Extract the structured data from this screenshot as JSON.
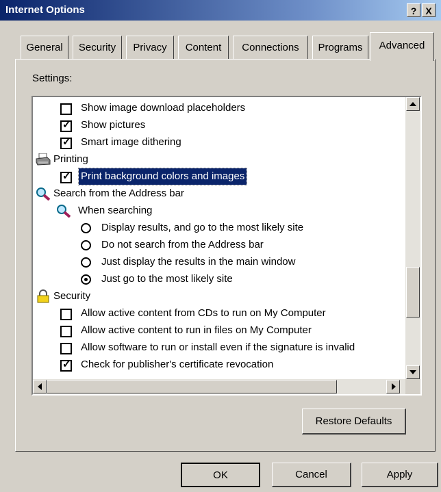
{
  "window": {
    "title": "Internet Options",
    "help_label": "?",
    "close_label": "X"
  },
  "tabs": [
    {
      "label": "General"
    },
    {
      "label": "Security"
    },
    {
      "label": "Privacy"
    },
    {
      "label": "Content"
    },
    {
      "label": "Connections"
    },
    {
      "label": "Programs"
    },
    {
      "label": "Advanced",
      "active": true
    }
  ],
  "settings": {
    "label": "Settings:",
    "items": [
      {
        "text": "Show image download placeholders",
        "type": "checkbox",
        "checked": false
      },
      {
        "text": "Show pictures",
        "type": "checkbox",
        "checked": true
      },
      {
        "text": "Smart image dithering",
        "type": "checkbox",
        "checked": true
      },
      {
        "text": "Printing",
        "type": "group",
        "icon": "printer-icon"
      },
      {
        "text": "Print background colors and images",
        "type": "checkbox",
        "checked": true,
        "selected": true
      },
      {
        "text": "Search from the Address bar",
        "type": "group",
        "icon": "magnifier-icon"
      },
      {
        "text": "When searching",
        "type": "subgroup",
        "icon": "magnifier-icon"
      },
      {
        "text": "Display results, and go to the most likely site",
        "type": "radio",
        "checked": false
      },
      {
        "text": "Do not search from the Address bar",
        "type": "radio",
        "checked": false
      },
      {
        "text": "Just display the results in the main window",
        "type": "radio",
        "checked": false
      },
      {
        "text": "Just go to the most likely site",
        "type": "radio",
        "checked": true
      },
      {
        "text": "Security",
        "type": "group",
        "icon": "padlock-icon"
      },
      {
        "text": "Allow active content from CDs to run on My Computer",
        "type": "checkbox",
        "checked": false
      },
      {
        "text": "Allow active content to run in files on My Computer",
        "type": "checkbox",
        "checked": false
      },
      {
        "text": "Allow software to run or install even if the signature is invalid",
        "type": "checkbox",
        "checked": false
      },
      {
        "text": "Check for publisher's certificate revocation",
        "type": "checkbox",
        "checked": true
      }
    ]
  },
  "buttons": {
    "restore_defaults": "Restore Defaults",
    "ok": "OK",
    "cancel": "Cancel",
    "apply": "Apply"
  },
  "check_glyph": "✓"
}
